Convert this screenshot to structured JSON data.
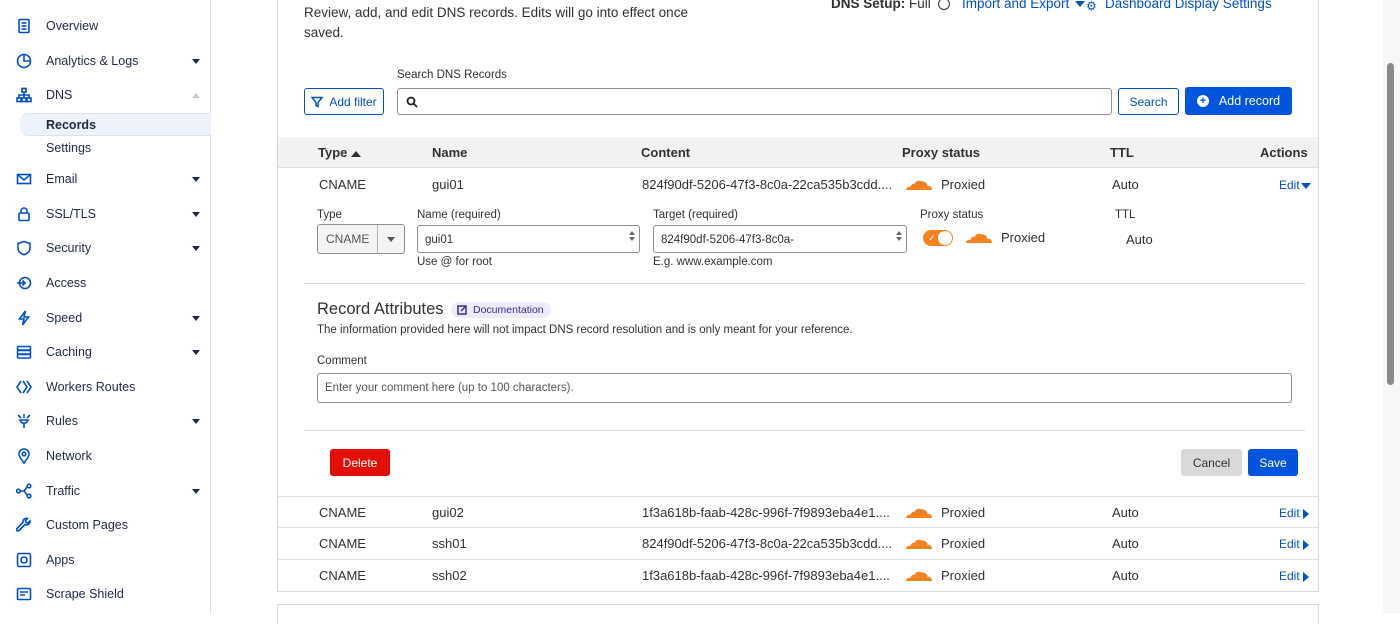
{
  "sidebar": {
    "items": [
      {
        "label": "Overview",
        "icon": "document-icon"
      },
      {
        "label": "Analytics & Logs",
        "icon": "analytics-icon"
      },
      {
        "label": "DNS",
        "icon": "dns-icon"
      },
      {
        "label": "Email",
        "icon": "email-icon"
      },
      {
        "label": "SSL/TLS",
        "icon": "lock-icon"
      },
      {
        "label": "Security",
        "icon": "shield-icon"
      },
      {
        "label": "Access",
        "icon": "access-icon"
      },
      {
        "label": "Speed",
        "icon": "bolt-icon"
      },
      {
        "label": "Caching",
        "icon": "database-icon"
      },
      {
        "label": "Workers Routes",
        "icon": "workers-icon"
      },
      {
        "label": "Rules",
        "icon": "rules-icon"
      },
      {
        "label": "Network",
        "icon": "location-pin-icon"
      },
      {
        "label": "Traffic",
        "icon": "traffic-icon"
      },
      {
        "label": "Custom Pages",
        "icon": "wrench-icon"
      },
      {
        "label": "Apps",
        "icon": "apps-icon"
      },
      {
        "label": "Scrape Shield",
        "icon": "scrape-shield-icon"
      }
    ],
    "dns_sub": [
      "Records",
      "Settings"
    ]
  },
  "header": {
    "description": "Review, add, and edit DNS records. Edits will go into effect once saved.",
    "dns_setup_label": "DNS Setup:",
    "dns_setup_value": "Full",
    "import_export": "Import and Export",
    "dashboard_settings": "Dashboard Display Settings"
  },
  "search": {
    "label": "Search DNS Records",
    "placeholder": "",
    "add_filter": "Add filter",
    "search_button": "Search",
    "add_record": "Add record"
  },
  "table": {
    "columns": [
      "Type",
      "Name",
      "Content",
      "Proxy status",
      "TTL",
      "Actions"
    ],
    "rows": [
      {
        "type": "CNAME",
        "name": "gui01",
        "content": "824f90df-5206-47f3-8c0a-22ca535b3cdd....",
        "proxy": "Proxied",
        "ttl": "Auto",
        "action": "Edit"
      },
      {
        "type": "CNAME",
        "name": "gui02",
        "content": "1f3a618b-faab-428c-996f-7f9893eba4e1....",
        "proxy": "Proxied",
        "ttl": "Auto",
        "action": "Edit"
      },
      {
        "type": "CNAME",
        "name": "ssh01",
        "content": "824f90df-5206-47f3-8c0a-22ca535b3cdd....",
        "proxy": "Proxied",
        "ttl": "Auto",
        "action": "Edit"
      },
      {
        "type": "CNAME",
        "name": "ssh02",
        "content": "1f3a618b-faab-428c-996f-7f9893eba4e1....",
        "proxy": "Proxied",
        "ttl": "Auto",
        "action": "Edit"
      }
    ]
  },
  "edit_form": {
    "type_label": "Type",
    "type_value": "CNAME",
    "name_label": "Name (required)",
    "name_value": "gui01",
    "name_hint": "Use @ for root",
    "target_label": "Target (required)",
    "target_value": "824f90df-5206-47f3-8c0a-",
    "target_hint": "E.g. www.example.com",
    "proxy_label": "Proxy status",
    "proxy_value": "Proxied",
    "proxy_enabled": true,
    "ttl_label": "TTL",
    "ttl_value": "Auto",
    "attributes_title": "Record Attributes",
    "documentation": "Documentation",
    "attributes_info": "The information provided here will not impact DNS record resolution and is only meant for your reference.",
    "comment_label": "Comment",
    "comment_placeholder": "Enter your comment here (up to 100 characters).",
    "delete": "Delete",
    "cancel": "Cancel",
    "save": "Save"
  },
  "colors": {
    "accent": "#0055dc",
    "link": "#0051c3",
    "cloud_orange": "#f6821f",
    "danger": "#e20f06"
  }
}
